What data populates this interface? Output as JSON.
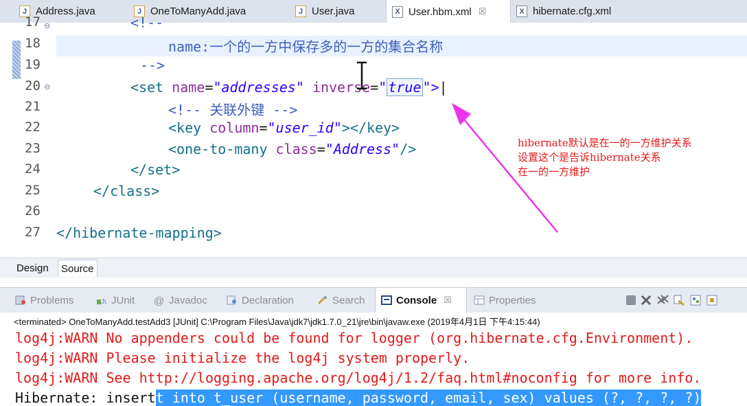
{
  "editor_tabs": [
    {
      "label": "Address.java",
      "icon": "java-file-icon"
    },
    {
      "label": "OneToManyAdd.java",
      "icon": "java-file-icon"
    },
    {
      "label": "User.java",
      "icon": "java-file-icon"
    },
    {
      "label": "User.hbm.xml",
      "icon": "xml-file-icon",
      "active": true,
      "close": "☒"
    },
    {
      "label": "hibernate.cfg.xml",
      "icon": "xml-file-icon"
    }
  ],
  "code_lines": [
    {
      "n": "17"
    },
    {
      "n": "18",
      "text": "name:一个的一方中保存多的一方的集合名称"
    },
    {
      "n": "19",
      "text": "-->"
    },
    {
      "n": "20",
      "tag_open": "<set",
      "attr1": "name",
      "val1": "\"addresses\"",
      "attr2": "inverse",
      "val2_q": "\"",
      "val2": "true",
      "val2_end": "\">"
    },
    {
      "n": "21",
      "text": "<!-- 关联外键 -->"
    },
    {
      "n": "22",
      "tag": "<key",
      "attr": "column",
      "val": "\"user_id\"",
      "tail": "></key>"
    },
    {
      "n": "23",
      "tag": "<one-to-many",
      "attr": "class",
      "val": "\"Address\"",
      "tail": "/>"
    },
    {
      "n": "24",
      "text": "</set>"
    },
    {
      "n": "25",
      "text": "</class>"
    },
    {
      "n": "26",
      "text": ""
    },
    {
      "n": "27",
      "text": "</hibernate-mapping>"
    }
  ],
  "comment_open": "<!--",
  "annotation": [
    "hibernate默认是在一的一方维护关系",
    "设置这个是告诉hibernate关系",
    "在一的一方维护"
  ],
  "design_tabs": {
    "design": "Design",
    "source": "Source"
  },
  "view_tabs": [
    "Problems",
    "JUnit",
    "Javadoc",
    "Declaration",
    "Search",
    "Console",
    "Properties"
  ],
  "view_tab_close": "☒",
  "console_status": "<terminated> OneToManyAdd.testAdd3 [JUnit] C:\\Program Files\\Java\\jdk7\\jdk1.7.0_21\\jre\\bin\\javaw.exe (2019年4月1日 下午4:15:44)",
  "console_lines": [
    "log4j:WARN No appenders could be found for logger (org.hibernate.cfg.Environment).",
    "log4j:WARN Please initialize the log4j system properly.",
    "log4j:WARN See http://logging.apache.org/log4j/1.2/faq.html#noconfig for more info."
  ],
  "console_last": {
    "plain": "Hibernate: insert",
    "selected": "t into t_user (username, password, email, sex) values (?, ?, ?, ?)"
  },
  "colors": {
    "annotation": "#e31b1b",
    "arrow": "#ee33ee",
    "error": "#e21a1a",
    "selection": "#3399ff"
  }
}
